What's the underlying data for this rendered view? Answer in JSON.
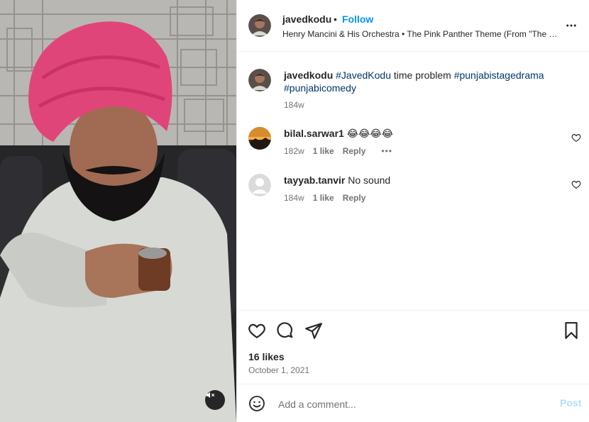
{
  "header": {
    "username": "javedkodu",
    "separator": "•",
    "follow_label": "Follow",
    "audio": "Henry Mancini & His Orchestra • The Pink Panther Theme (From \"The Pink Panther\")"
  },
  "caption": {
    "username": "javedkodu",
    "hashtag1": "#JavedKodu",
    "text": "time problem",
    "hashtag2": "#punjabistagedrama",
    "hashtag3": "#punjabicomedy",
    "time": "184w"
  },
  "comments": [
    {
      "username": "bilal.sarwar1",
      "text": "😂😂😂😂",
      "time": "182w",
      "likes": "1 like",
      "reply": "Reply",
      "more": "•••"
    },
    {
      "username": "tayyab.tanvir",
      "text": "No sound",
      "time": "184w",
      "likes": "1 like",
      "reply": "Reply"
    }
  ],
  "actions": {
    "likes": "16 likes",
    "date": "October 1, 2021"
  },
  "composer": {
    "placeholder": "Add a comment...",
    "post_label": "Post"
  },
  "icons": {
    "more": "more-horizontal-icon",
    "like": "heart-icon",
    "comment": "comment-bubble-icon",
    "share": "paper-plane-icon",
    "save": "bookmark-icon",
    "emoji": "emoji-smile-icon",
    "audio": "speaker-muted-icon"
  },
  "colors": {
    "accent": "#0095f6",
    "hashtag": "#00376b",
    "muted": "#737373",
    "post_disabled": "#b2dffc"
  }
}
